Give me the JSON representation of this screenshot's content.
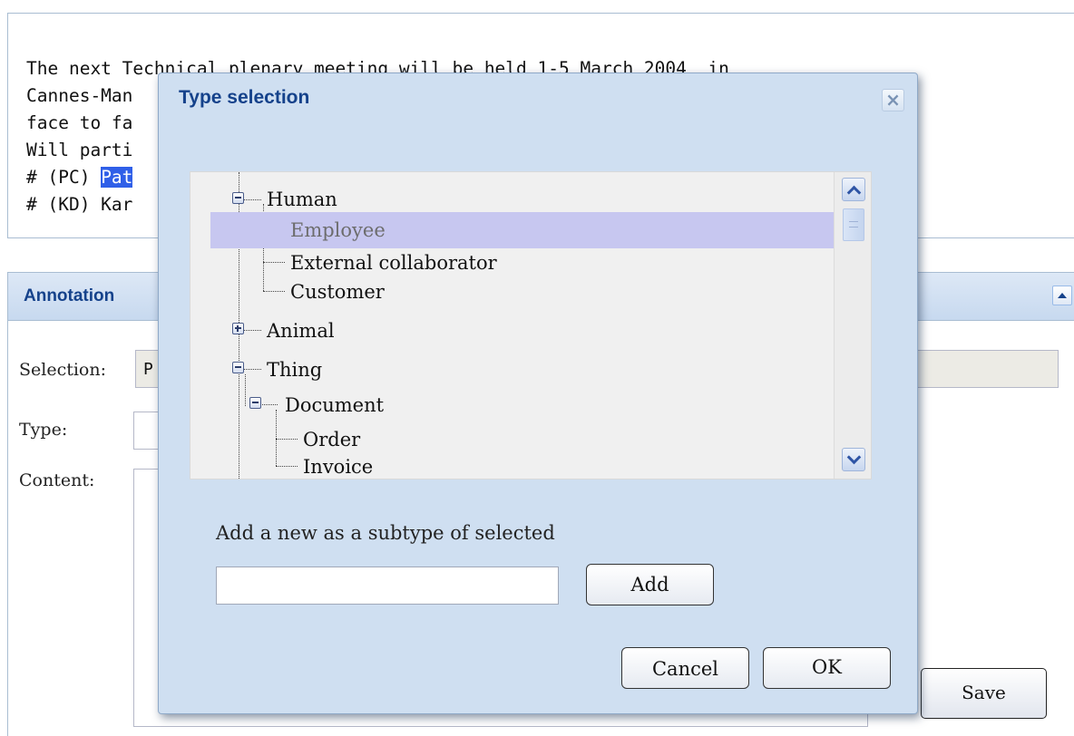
{
  "document": {
    "lines": [
      "The next Technical plenary meeting will be held 1-5 March 2004  in",
      "Cannes-Man",
      "face to fa",
      "Will parti",
      "# (PC) ",
      "# (KD) Kar"
    ],
    "highlight": "Pat"
  },
  "annotation": {
    "title": "Annotation",
    "selection_label": "Selection:",
    "selection_value": "P",
    "type_label": "Type:",
    "content_label": "Content:",
    "save_label": "Save"
  },
  "dialog": {
    "title": "Type selection",
    "close_glyph": "×",
    "tree": {
      "human": "Human",
      "employee": "Employee",
      "external": "External collaborator",
      "customer": "Customer",
      "animal": "Animal",
      "thing": "Thing",
      "document": "Document",
      "order": "Order",
      "invoice": "Invoice"
    },
    "selected_item": "Employee",
    "add_prompt": "Add a new as a subtype of selected",
    "new_type_value": "",
    "add_label": "Add",
    "cancel_label": "Cancel",
    "ok_label": "OK"
  },
  "colors": {
    "header_text": "#15428b",
    "highlight_bg": "#2f5fe8",
    "selected_row_bg": "#c7c7f0",
    "dialog_bg": "#cfdff1"
  },
  "icons": {
    "collapse": "triangle-up-icon",
    "close": "close-icon",
    "tree_expanded": "minus-box-icon",
    "tree_collapsed": "plus-box-icon",
    "scroll_up": "chevron-up-icon",
    "scroll_down": "chevron-down-icon"
  }
}
